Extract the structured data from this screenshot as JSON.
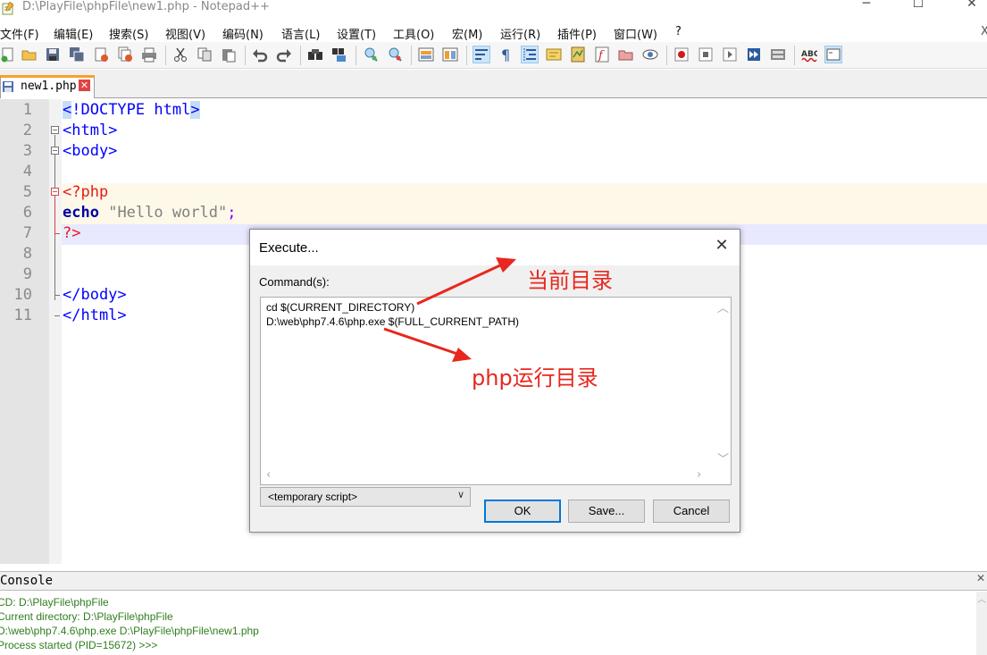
{
  "window": {
    "title": "D:\\PlayFile\\phpFile\\new1.php - Notepad++",
    "controls": [
      "─",
      "☐",
      "✕"
    ]
  },
  "menu": [
    "文件(F)",
    "编辑(E)",
    "搜索(S)",
    "视图(V)",
    "编码(N)",
    "语言(L)",
    "设置(T)",
    "工具(O)",
    "宏(M)",
    "运行(R)",
    "插件(P)",
    "窗口(W)",
    "?"
  ],
  "menu_close": "X",
  "toolbar": {
    "icons": [
      "new-file-icon",
      "open-file-icon",
      "save-icon",
      "save-all-icon",
      "close-icon",
      "close-all-icon",
      "print-icon",
      "cut-icon",
      "copy-icon",
      "paste-icon",
      "undo-icon",
      "redo-icon",
      "find-icon",
      "replace-icon",
      "zoom-in-icon",
      "zoom-out-icon",
      "sync-vertical-icon",
      "sync-horizontal-icon",
      "word-wrap-icon",
      "show-all-chars-icon",
      "indent-guide-icon",
      "user-lang-icon",
      "doc-map-icon",
      "function-list-icon",
      "folder-as-workspace-icon",
      "monitoring-icon",
      "record-macro-icon",
      "stop-record-icon",
      "play-macro-icon",
      "run-macro-multiple-icon",
      "save-macro-icon",
      "spell-check-icon",
      "console-icon"
    ]
  },
  "tab": {
    "label": "new1.php",
    "close": "✕"
  },
  "editor": {
    "line_numbers": [
      "1",
      "2",
      "3",
      "4",
      "5",
      "6",
      "7",
      "8",
      "9",
      "10",
      "11"
    ],
    "lines": [
      [
        {
          "t": "<",
          "c": "tag brace"
        },
        {
          "t": "!DOCTYPE html",
          "c": "tag"
        },
        {
          "t": ">",
          "c": "tag brace"
        }
      ],
      [
        {
          "t": "<html>",
          "c": "tag"
        }
      ],
      [
        {
          "t": "<body>",
          "c": "tag"
        }
      ],
      [],
      [
        {
          "t": "<?php",
          "c": "php-tag"
        }
      ],
      [
        {
          "t": "echo",
          "c": "kw"
        },
        {
          "t": " ",
          "c": ""
        },
        {
          "t": "\"Hello world\"",
          "c": "str"
        },
        {
          "t": ";",
          "c": "punct"
        }
      ],
      [
        {
          "t": "?>",
          "c": "php-tag"
        }
      ],
      [],
      [],
      [
        {
          "t": "</body>",
          "c": "tag"
        }
      ],
      [
        {
          "t": "</html>",
          "c": "tag"
        }
      ]
    ]
  },
  "console": {
    "title": "Console",
    "close": "✕",
    "lines": [
      "CD: D:\\PlayFile\\phpFile",
      "Current directory: D:\\PlayFile\\phpFile",
      "D:\\web\\php7.4.6\\php.exe D:\\PlayFile\\phpFile\\new1.php",
      "Process started (PID=15672) >>>"
    ]
  },
  "dialog": {
    "title": "Execute...",
    "close": "✕",
    "label": "Command(s):",
    "commands": [
      "cd $(CURRENT_DIRECTORY)",
      "D:\\web\\php7.4.6\\php.exe $(FULL_CURRENT_PATH)"
    ],
    "select_value": "<temporary script>",
    "buttons": {
      "ok": "OK",
      "save": "Save...",
      "cancel": "Cancel"
    }
  },
  "annotations": {
    "current_dir": "当前目录",
    "php_dir": "php运行目录",
    "color": "#e8271e"
  }
}
